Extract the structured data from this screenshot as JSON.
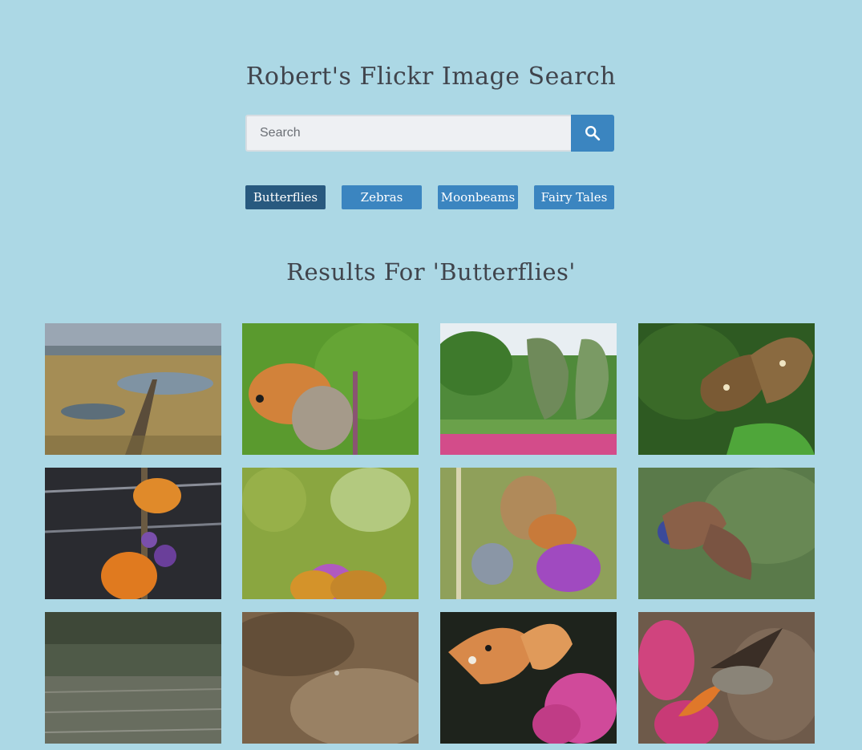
{
  "header": {
    "title": "Robert's Flickr Image Search"
  },
  "search": {
    "placeholder": "Search",
    "value": "",
    "button_icon": "search-icon"
  },
  "nav": {
    "buttons": [
      {
        "label": "Butterflies",
        "active": true
      },
      {
        "label": "Zebras",
        "active": false
      },
      {
        "label": "Moonbeams",
        "active": false
      },
      {
        "label": "Fairy Tales",
        "active": false
      }
    ]
  },
  "results": {
    "heading": "Results For 'Butterflies'"
  },
  "colors": {
    "background": "#acd8e5",
    "accent": "#3b85c0",
    "active": "#28597f",
    "text": "#40444c"
  }
}
